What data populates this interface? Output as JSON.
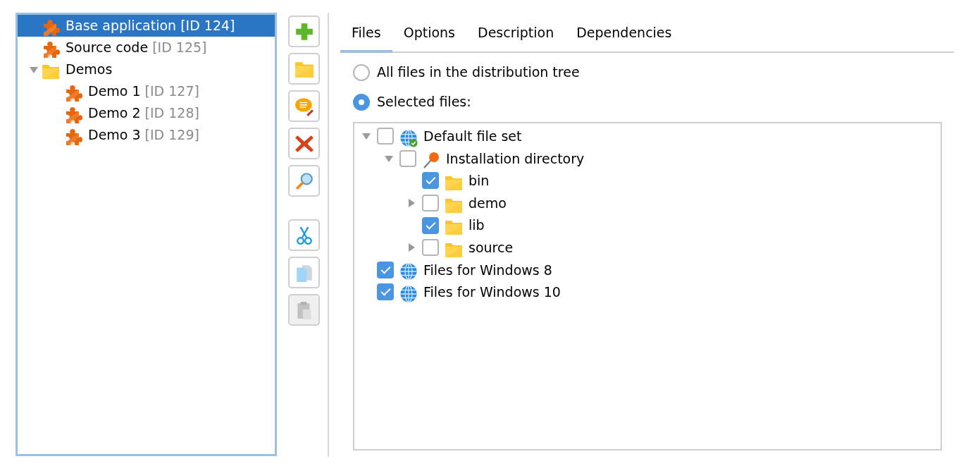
{
  "component_tree": [
    {
      "kind": "component",
      "name": "Base application",
      "id_label": "[ID 124]",
      "selected": true
    },
    {
      "kind": "component",
      "name": "Source code",
      "id_label": "[ID 125]",
      "selected": false
    },
    {
      "kind": "folder",
      "name": "Demos",
      "selected": false,
      "expanded": true,
      "children": [
        {
          "kind": "component",
          "name": "Demo 1",
          "id_label": "[ID 127]",
          "selected": false
        },
        {
          "kind": "component",
          "name": "Demo 2",
          "id_label": "[ID 128]",
          "selected": false
        },
        {
          "kind": "component",
          "name": "Demo 3",
          "id_label": "[ID 129]",
          "selected": false
        }
      ]
    }
  ],
  "toolbar": [
    {
      "kind": "add",
      "disabled": false
    },
    {
      "kind": "folder",
      "disabled": false
    },
    {
      "kind": "comment",
      "disabled": false
    },
    {
      "kind": "delete",
      "disabled": false
    },
    {
      "kind": "search",
      "disabled": false
    },
    {
      "kind": "separator"
    },
    {
      "kind": "cut",
      "disabled": false
    },
    {
      "kind": "copy",
      "disabled": false
    },
    {
      "kind": "paste",
      "disabled": true
    }
  ],
  "tabs": [
    {
      "label": "Files",
      "selected": true
    },
    {
      "label": "Options",
      "selected": false
    },
    {
      "label": "Description",
      "selected": false
    },
    {
      "label": "Dependencies",
      "selected": false
    }
  ],
  "radios": [
    {
      "label": "All files in the distribution tree",
      "selected": false
    },
    {
      "label": "Selected files:",
      "selected": true
    }
  ],
  "file_tree": [
    {
      "kind": "globe-check",
      "label": "Default file set",
      "checked": false,
      "expanded": true,
      "children": [
        {
          "kind": "pin",
          "label": "Installation directory",
          "checked": false,
          "expanded": true,
          "children": [
            {
              "kind": "folder",
              "label": "bin",
              "checked": true
            },
            {
              "kind": "folder",
              "label": "demo",
              "checked": false,
              "expanded": false
            },
            {
              "kind": "folder",
              "label": "lib",
              "checked": true
            },
            {
              "kind": "folder",
              "label": "source",
              "checked": false,
              "expanded": false
            }
          ]
        }
      ]
    },
    {
      "kind": "globe",
      "label": "Files for Windows 8",
      "checked": true
    },
    {
      "kind": "globe",
      "label": "Files for Windows 10",
      "checked": true
    }
  ]
}
